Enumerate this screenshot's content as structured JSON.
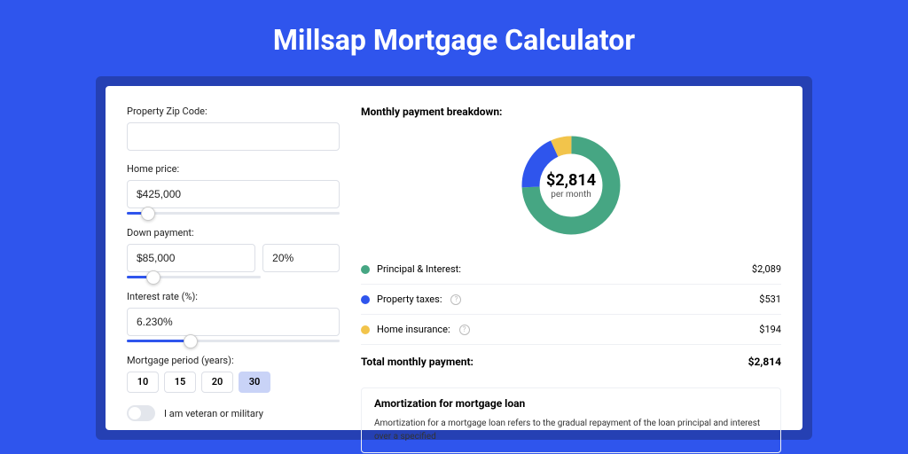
{
  "title": "Millsap Mortgage Calculator",
  "form": {
    "zip_label": "Property Zip Code:",
    "zip_value": "",
    "home_price_label": "Home price:",
    "home_price_value": "$425,000",
    "home_price_pct": 10,
    "down_payment_label": "Down payment:",
    "down_payment_value": "$85,000",
    "down_payment_pct_value": "20%",
    "down_payment_slider_pct": 20,
    "rate_label": "Interest rate (%):",
    "rate_value": "6.230%",
    "rate_slider_pct": 30,
    "period_label": "Mortgage period (years):",
    "period_options": [
      "10",
      "15",
      "20",
      "30"
    ],
    "period_selected": "30",
    "veteran_label": "I am veteran or military",
    "veteran_on": false
  },
  "breakdown": {
    "title": "Monthly payment breakdown:",
    "center_amount": "$2,814",
    "center_sub": "per month",
    "items": [
      {
        "label": "Principal & Interest:",
        "value": "$2,089",
        "color": "#46a683",
        "help": false
      },
      {
        "label": "Property taxes:",
        "value": "$531",
        "color": "#2f55ed",
        "help": true
      },
      {
        "label": "Home insurance:",
        "value": "$194",
        "color": "#f2c44b",
        "help": true
      }
    ],
    "total_label": "Total monthly payment:",
    "total_value": "$2,814"
  },
  "chart_data": {
    "type": "pie",
    "title": "Monthly payment breakdown",
    "series": [
      {
        "name": "Principal & Interest",
        "value": 2089,
        "color": "#46a683"
      },
      {
        "name": "Property taxes",
        "value": 531,
        "color": "#2f55ed"
      },
      {
        "name": "Home insurance",
        "value": 194,
        "color": "#f2c44b"
      }
    ],
    "total": 2814,
    "center_label": "$2,814 per month"
  },
  "amortization": {
    "title": "Amortization for mortgage loan",
    "text": "Amortization for a mortgage loan refers to the gradual repayment of the loan principal and interest over a specified"
  }
}
